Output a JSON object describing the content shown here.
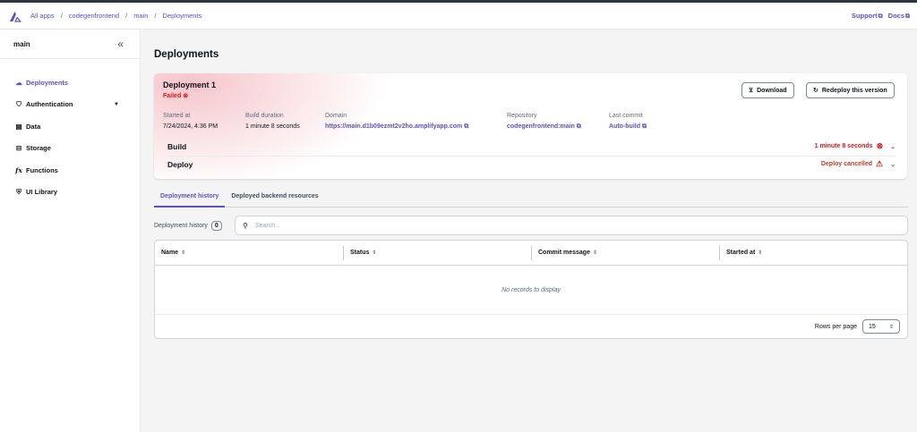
{
  "header": {
    "breadcrumbs": [
      {
        "label": "All apps"
      },
      {
        "label": "codegenfrontend"
      },
      {
        "label": "main"
      },
      {
        "label": "Deployments"
      }
    ],
    "support_label": "Support",
    "docs_label": "Docs"
  },
  "sidebar": {
    "title": "main",
    "items": [
      {
        "label": "Deployments",
        "icon": "cloud-icon",
        "active": true
      },
      {
        "label": "Authentication",
        "icon": "shield-icon"
      },
      {
        "label": "Data",
        "icon": "database-icon"
      },
      {
        "label": "Storage",
        "icon": "storage-icon"
      },
      {
        "label": "Functions",
        "icon": "function-icon"
      },
      {
        "label": "UI Library",
        "icon": "ui-library-icon"
      }
    ]
  },
  "page": {
    "title": "Deployments"
  },
  "deployment": {
    "title": "Deployment 1",
    "status": "Failed",
    "download_label": "Download",
    "redeploy_label": "Redeploy this version",
    "started_at": {
      "label": "Started at",
      "value": "7/24/2024, 4:36 PM"
    },
    "build_duration": {
      "label": "Build duration",
      "value": "1 minute 8 seconds"
    },
    "domain": {
      "label": "Domain",
      "value": "https://main.d1b09ezmt2v2ho.amplifyapp.com"
    },
    "repository": {
      "label": "Repository",
      "value": "codegenfrontend:main"
    },
    "last_commit": {
      "label": "Last commit",
      "value": "Auto-build"
    },
    "build": {
      "label": "Build",
      "status": "1 minute 8 seconds"
    },
    "deploy": {
      "label": "Deploy",
      "status": "Deploy cancelled"
    },
    "colors": {
      "error": "#d91515",
      "warning": "#c4381d",
      "link": "#5b4fd6"
    }
  },
  "tabs": [
    {
      "label": "Deployment history",
      "active": true
    },
    {
      "label": "Deployed backend resources"
    }
  ],
  "history": {
    "label": "Deployment history",
    "count": "0",
    "search_placeholder": "Search...",
    "columns": [
      "Name",
      "Status",
      "Commit message",
      "Started at"
    ],
    "empty_text": "No records to display",
    "rows_per_page_label": "Rows per page",
    "rows_per_page": "15"
  }
}
